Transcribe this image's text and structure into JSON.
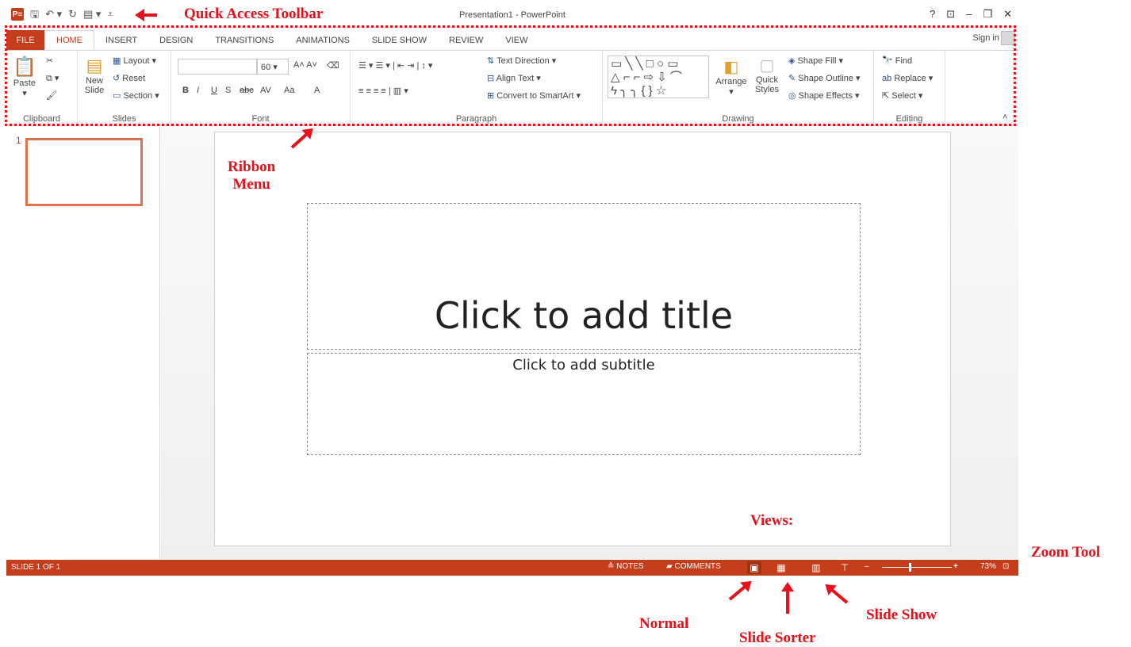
{
  "window": {
    "title": "Presentation1 - PowerPoint",
    "controls": [
      "?",
      "⊡",
      "–",
      "❐",
      "✕"
    ],
    "sign_in": "Sign in"
  },
  "qat": {
    "logo": "P≡",
    "save_icon": "save-icon",
    "undo_icon": "undo-icon",
    "redo_icon": "redo-icon",
    "start_from_beginning_icon": "slideshow-start-icon",
    "customize_icon": "customize-qat-icon"
  },
  "tabs": [
    "FILE",
    "HOME",
    "INSERT",
    "DESIGN",
    "TRANSITIONS",
    "ANIMATIONS",
    "SLIDE SHOW",
    "REVIEW",
    "VIEW"
  ],
  "ribbon": {
    "clipboard": {
      "label": "Clipboard",
      "paste": "Paste"
    },
    "slides": {
      "label": "Slides",
      "new_slide": "New Slide",
      "layout": "Layout",
      "reset": "Reset",
      "section": "Section"
    },
    "font": {
      "label": "Font",
      "size": "60",
      "bold": "B",
      "italic": "I",
      "underline": "U",
      "shadow": "S",
      "strike": "abc",
      "spacing": "AV",
      "case": "Aa",
      "color": "A"
    },
    "paragraph": {
      "label": "Paragraph",
      "text_direction": "Text Direction",
      "align_text": "Align Text",
      "smartart": "Convert to SmartArt"
    },
    "drawing": {
      "label": "Drawing",
      "arrange": "Arrange",
      "quick_styles": "Quick Styles",
      "shape_fill": "Shape Fill",
      "shape_outline": "Shape Outline",
      "shape_effects": "Shape Effects"
    },
    "editing": {
      "label": "Editing",
      "find": "Find",
      "replace": "Replace",
      "select": "Select"
    }
  },
  "thumbs": {
    "number": "1"
  },
  "slide": {
    "title_placeholder": "Click to add title",
    "subtitle_placeholder": "Click to add subtitle"
  },
  "status": {
    "slide_count": "SLIDE 1 OF 1",
    "notes": "≙ NOTES",
    "comments": "COMMENTS",
    "zoom": "73%"
  },
  "annotations": {
    "qat": "Quick Access Toolbar",
    "ribbon_line1": "Ribbon",
    "ribbon_line2": "Menu",
    "views": "Views:",
    "zoom": "Zoom Tool",
    "normal": "Normal",
    "sorter": "Slide Sorter",
    "show": "Slide Show"
  },
  "colors": {
    "accent": "#c43e1c",
    "annotation": "#e8101a"
  }
}
